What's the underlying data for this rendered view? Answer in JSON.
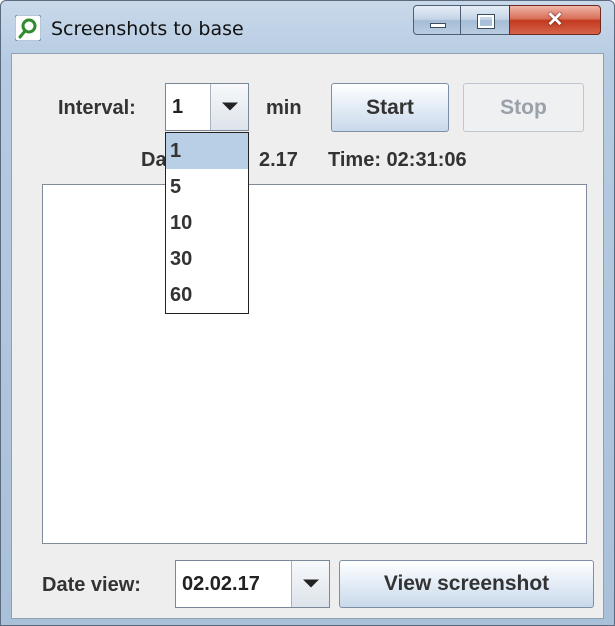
{
  "window": {
    "title": "Screenshots to base"
  },
  "controls": {
    "interval_label": "Interval:",
    "interval_value": "1",
    "unit_label": "min",
    "start_label": "Start",
    "stop_label": "Stop",
    "date_label_visible": "Da",
    "date_label_suffix": "2.17",
    "time_label": "Time: 02:31:06"
  },
  "dropdown": {
    "options": [
      "1",
      "5",
      "10",
      "30",
      "60"
    ],
    "selected": "1"
  },
  "footer": {
    "date_view_label": "Date view:",
    "date_view_value": "02.02.17",
    "view_button_label": "View screenshot"
  },
  "icons": [
    "app-icon",
    "minimize-icon",
    "maximize-icon",
    "close-icon",
    "dropdown-arrow-icon"
  ]
}
